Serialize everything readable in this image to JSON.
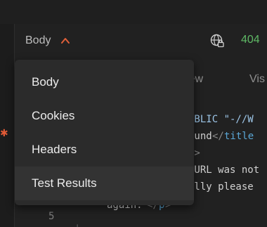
{
  "response_header": {
    "body_toggle_label": "Body",
    "status_code": "404"
  },
  "tabs": {
    "partial_preview": "iew",
    "partial_visualize": "Vis"
  },
  "code": {
    "line1_partial": "UBLIC \"-//W",
    "line2_text": "ound",
    "line2_tag": "title",
    "line3_punc": "l>",
    "line4_text": " URL was not",
    "line5_text": "ally please",
    "line6_number": "5",
    "line6_text": "again.",
    "line6_tag_open": "</",
    "line6_tag": "p",
    "line6_tag_close": ">"
  },
  "dropdown": {
    "items": [
      {
        "label": "Body"
      },
      {
        "label": "Cookies"
      },
      {
        "label": "Headers"
      },
      {
        "label": "Test Results"
      }
    ],
    "selected": "Test Results"
  },
  "colors": {
    "accent_chevron": "#e0603a",
    "status_ok_green": "#5fb865",
    "tag_blue": "#5aa7d6"
  },
  "icons": {
    "toggle": "chevron-up-icon",
    "network": "globe-lock-icon"
  }
}
